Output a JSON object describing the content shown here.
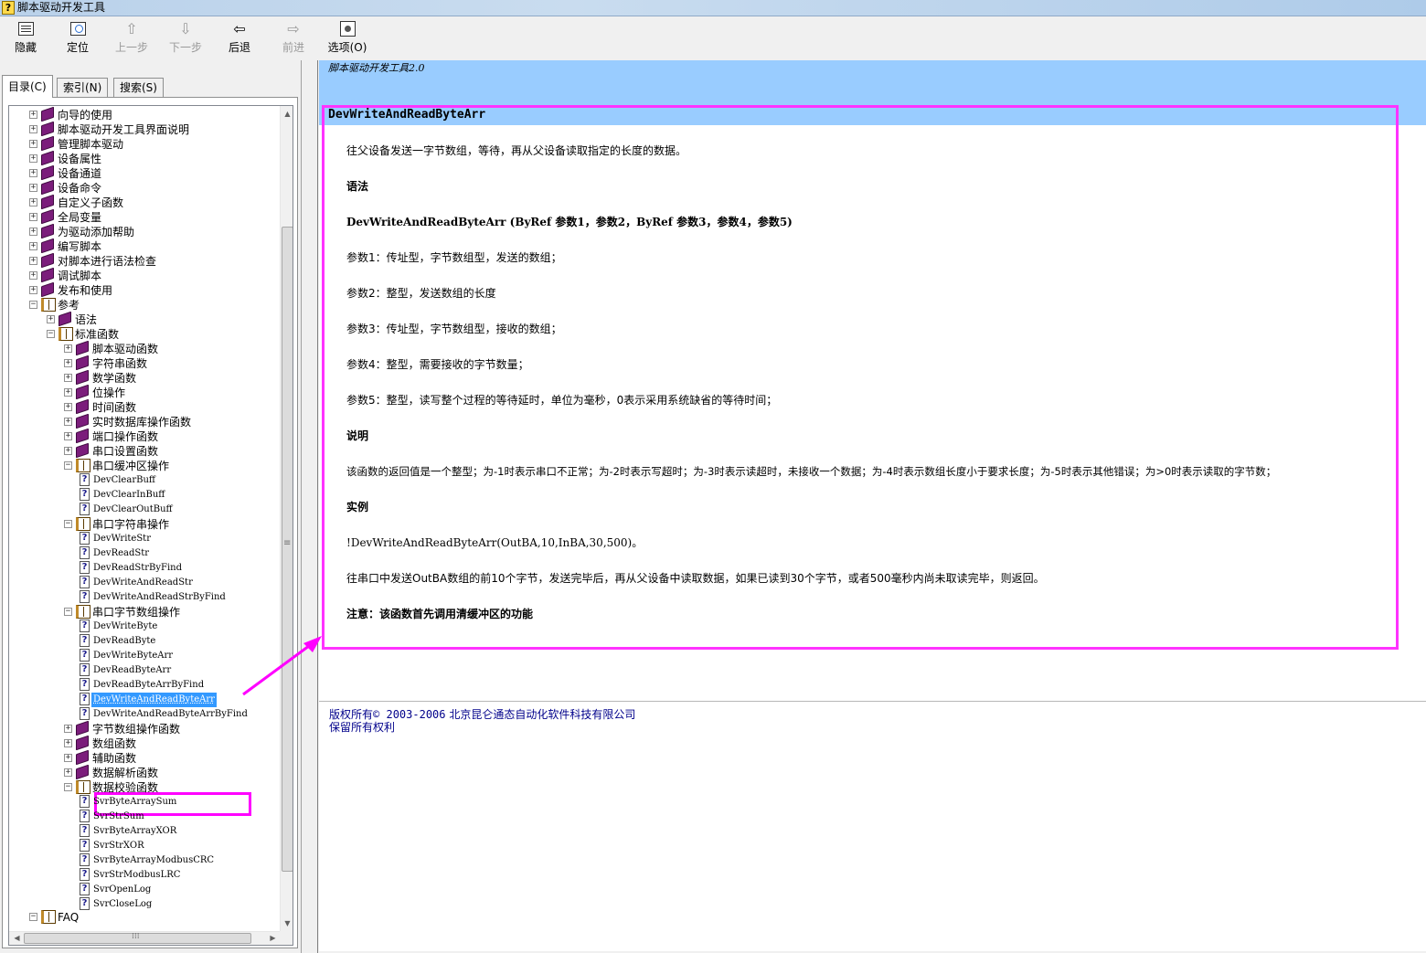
{
  "window": {
    "title": "脚本驱动开发工具"
  },
  "toolbar": {
    "hide": "隐藏",
    "locate": "定位",
    "prev": "上一步",
    "next": "下一步",
    "back": "后退",
    "forward": "前进",
    "options": "选项(O)"
  },
  "tabs": {
    "contents": "目录(C)",
    "index": "索引(N)",
    "search": "搜索(S)"
  },
  "tree": {
    "n0": "向导的使用",
    "n1": "脚本驱动开发工具界面说明",
    "n2": "管理脚本驱动",
    "n3": "设备属性",
    "n4": "设备通道",
    "n5": "设备命令",
    "n6": "自定义子函数",
    "n7": "全局变量",
    "n8": "为驱动添加帮助",
    "n9": "编写脚本",
    "n10": "对脚本进行语法检查",
    "n11": "调试脚本",
    "n12": "发布和使用",
    "n13": "参考",
    "n14": "语法",
    "n15": "标准函数",
    "n16": "脚本驱动函数",
    "n17": "字符串函数",
    "n18": "数学函数",
    "n19": "位操作",
    "n20": "时间函数",
    "n21": "实时数据库操作函数",
    "n22": "端口操作函数",
    "n23": "串口设置函数",
    "n24": "串口缓冲区操作",
    "n25": "DevClearBuff",
    "n26": "DevClearInBuff",
    "n27": "DevClearOutBuff",
    "n28": "串口字符串操作",
    "n29": "DevWriteStr",
    "n30": "DevReadStr",
    "n31": "DevReadStrByFind",
    "n32": "DevWriteAndReadStr",
    "n33": "DevWriteAndReadStrByFind",
    "n34": "串口字节数组操作",
    "n35": "DevWriteByte",
    "n36": "DevReadByte",
    "n37": "DevWriteByteArr",
    "n38": "DevReadByteArr",
    "n39": "DevReadByteArrByFind",
    "n40": "DevWriteAndReadByteArr",
    "n41": "DevWriteAndReadByteArrByFind",
    "n42": "字节数组操作函数",
    "n43": "数组函数",
    "n44": "辅助函数",
    "n45": "数据解析函数",
    "n46": "数据校验函数",
    "n47": "SvrByteArraySum",
    "n48": "SvrStrSum",
    "n49": "SvrByteArrayXOR",
    "n50": "SvrStrXOR",
    "n51": "SvrByteArrayModbusCRC",
    "n52": "SvrStrModbusLRC",
    "n53": "SvrOpenLog",
    "n54": "SvrCloseLog",
    "n55": "FAQ"
  },
  "content": {
    "brand": "脚本驱动开发工具2.0",
    "topic_title": "DevWriteAndReadByteArr",
    "p_desc": "往父设备发送一字节数组，等待，再从父设备读取指定的长度的数据。",
    "h_syntax": "语法",
    "p_signature": "DevWriteAndReadByteArr (ByRef 参数1，参数2，ByRef 参数3，参数4，参数5)",
    "p_arg1": "参数1：传址型，字节数组型，发送的数组；",
    "p_arg2": "参数2：整型，发送数组的长度",
    "p_arg3": "参数3：传址型，字节数组型，接收的数组；",
    "p_arg4": "参数4：整型，需要接收的字节数量；",
    "p_arg5": "参数5：整型，读写整个过程的等待延时，单位为毫秒，0表示采用系统缺省的等待时间；",
    "h_remarks": "说明",
    "p_remarks": "该函数的返回值是一个整型；为-1时表示串口不正常；为-2时表示写超时；为-3时表示读超时，未接收一个数据；为-4时表示数组长度小于要求长度；为-5时表示其他错误；为>0时表示读取的字节数；",
    "h_example": "实例",
    "p_example_code": "!DevWriteAndReadByteArr(OutBA,10,InBA,30,500)。",
    "p_example_desc": "往串口中发送OutBA数组的前10个字节，发送完毕后，再从父设备中读取数据，如果已读到30个字节，或者500毫秒内尚未取读完毕，则返回。",
    "p_note": "注意：该函数首先调用清缓冲区的功能",
    "copyright_prefix": "版权所有",
    "copyright_years": "© 2003-2006",
    "copyright_company": "北京昆仑通态自动化软件科技有限公司",
    "rights": "保留所有权利"
  },
  "colors": {
    "header_band": "#99ccff",
    "highlight": "#ff00ff",
    "selection": "#3399ff",
    "book_icon": "#7b1d7b",
    "link": "#00008b"
  }
}
